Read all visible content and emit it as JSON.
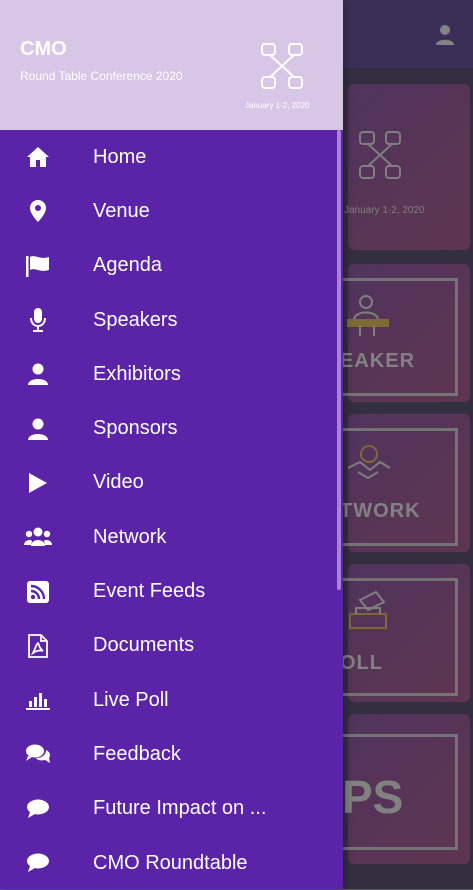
{
  "drawer": {
    "title": "CMO",
    "subtitle": "Round Table Conference 2020",
    "date": "January 1-2, 2020",
    "menu": [
      {
        "label": "Home",
        "icon": "home-icon"
      },
      {
        "label": "Venue",
        "icon": "map-pin-icon"
      },
      {
        "label": "Agenda",
        "icon": "flag-icon"
      },
      {
        "label": "Speakers",
        "icon": "microphone-icon"
      },
      {
        "label": "Exhibitors",
        "icon": "user-icon"
      },
      {
        "label": "Sponsors",
        "icon": "user-icon"
      },
      {
        "label": "Video",
        "icon": "play-icon"
      },
      {
        "label": "Network",
        "icon": "users-icon"
      },
      {
        "label": "Event Feeds",
        "icon": "rss-icon"
      },
      {
        "label": "Documents",
        "icon": "pdf-file-icon"
      },
      {
        "label": "Live Poll",
        "icon": "bar-chart-icon"
      },
      {
        "label": "Feedback",
        "icon": "comments-icon"
      },
      {
        "label": "Future Impact on ...",
        "icon": "comment-icon"
      },
      {
        "label": "CMO Roundtable",
        "icon": "comment-icon"
      }
    ]
  },
  "background": {
    "date": "January 1-2, 2020",
    "cards": [
      "EAKER",
      "TWORK",
      "OLL",
      "PS"
    ]
  },
  "colors": {
    "drawer": "#5b23a8",
    "header": "#d8c6e6",
    "card": "#7a2c7a"
  }
}
